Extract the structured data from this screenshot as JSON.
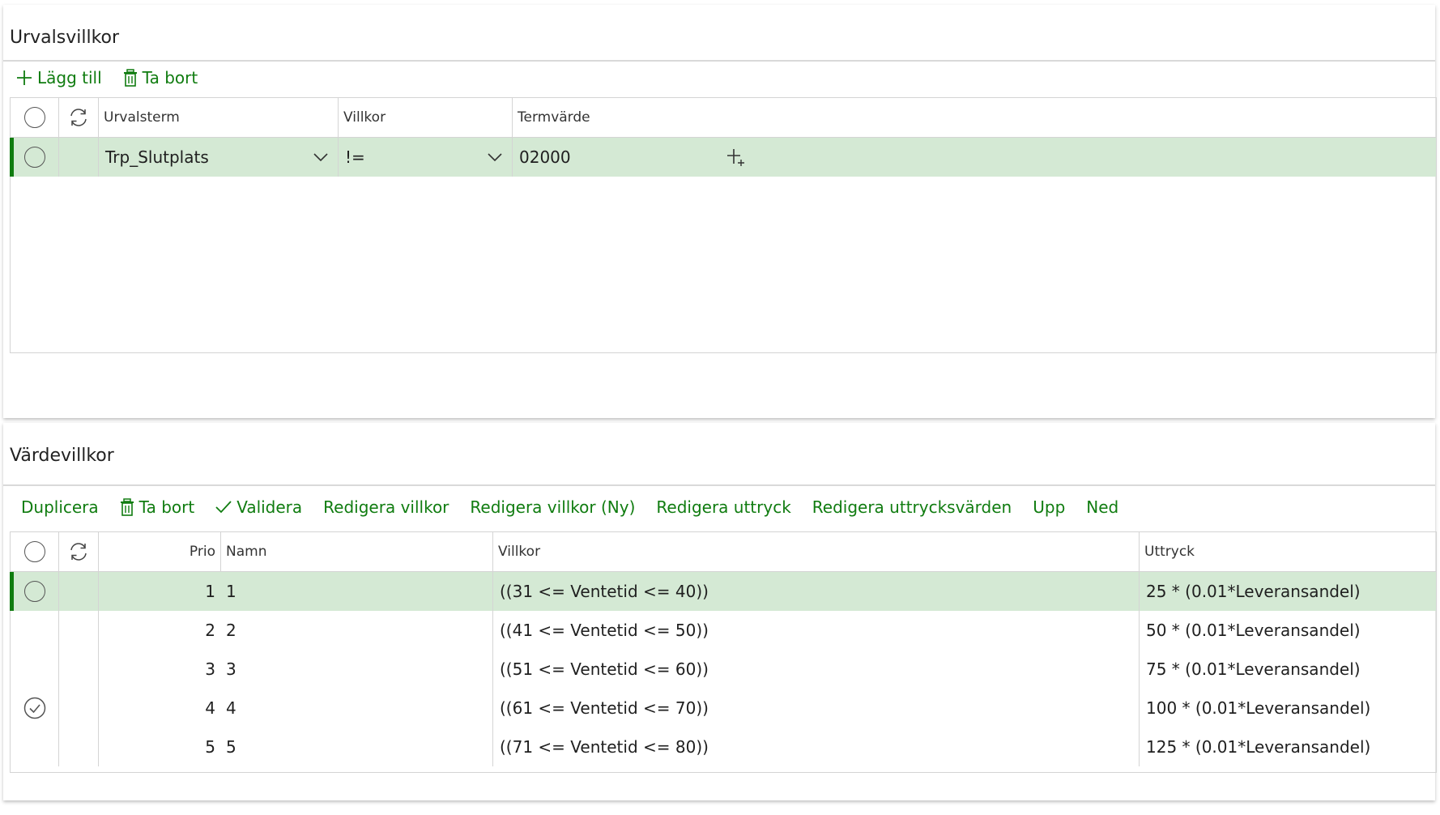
{
  "urval": {
    "title": "Urvalsvillkor",
    "toolbar": {
      "add_label": "Lägg till",
      "delete_label": "Ta bort"
    },
    "columns": {
      "term": "Urvalsterm",
      "condition": "Villkor",
      "value": "Termvärde"
    },
    "rows": [
      {
        "term": "Trp_Slutplats",
        "condition": "!=",
        "value": "02000"
      }
    ]
  },
  "varde": {
    "title": "Värdevillkor",
    "toolbar": {
      "duplicate_label": "Duplicera",
      "delete_label": "Ta bort",
      "validate_label": "Validera",
      "edit_conditions_label": "Redigera villkor",
      "edit_conditions_new_label": "Redigera villkor (Ny)",
      "edit_expression_label": "Redigera uttryck",
      "edit_expression_values_label": "Redigera uttrycksvärden",
      "up_label": "Upp",
      "down_label": "Ned"
    },
    "columns": {
      "prio": "Prio",
      "name": "Namn",
      "condition": "Villkor",
      "expression": "Uttryck"
    },
    "rows": [
      {
        "prio": "1",
        "name": "1",
        "condition": "((31 <= Ventetid <= 40))",
        "expression": "25 * (0.01*Leveransandel)"
      },
      {
        "prio": "2",
        "name": "2",
        "condition": "((41 <= Ventetid <= 50))",
        "expression": "50 * (0.01*Leveransandel)"
      },
      {
        "prio": "3",
        "name": "3",
        "condition": "((51 <= Ventetid <= 60))",
        "expression": "75 * (0.01*Leveransandel)"
      },
      {
        "prio": "4",
        "name": "4",
        "condition": "((61 <= Ventetid <= 70))",
        "expression": "100 * (0.01*Leveransandel)"
      },
      {
        "prio": "5",
        "name": "5",
        "condition": "((71 <= Ventetid <= 80))",
        "expression": "125 * (0.01*Leveransandel)"
      }
    ]
  },
  "colors": {
    "accent": "#107c10",
    "selected_row": "#d4e9d4",
    "border": "#d4d4d4"
  }
}
